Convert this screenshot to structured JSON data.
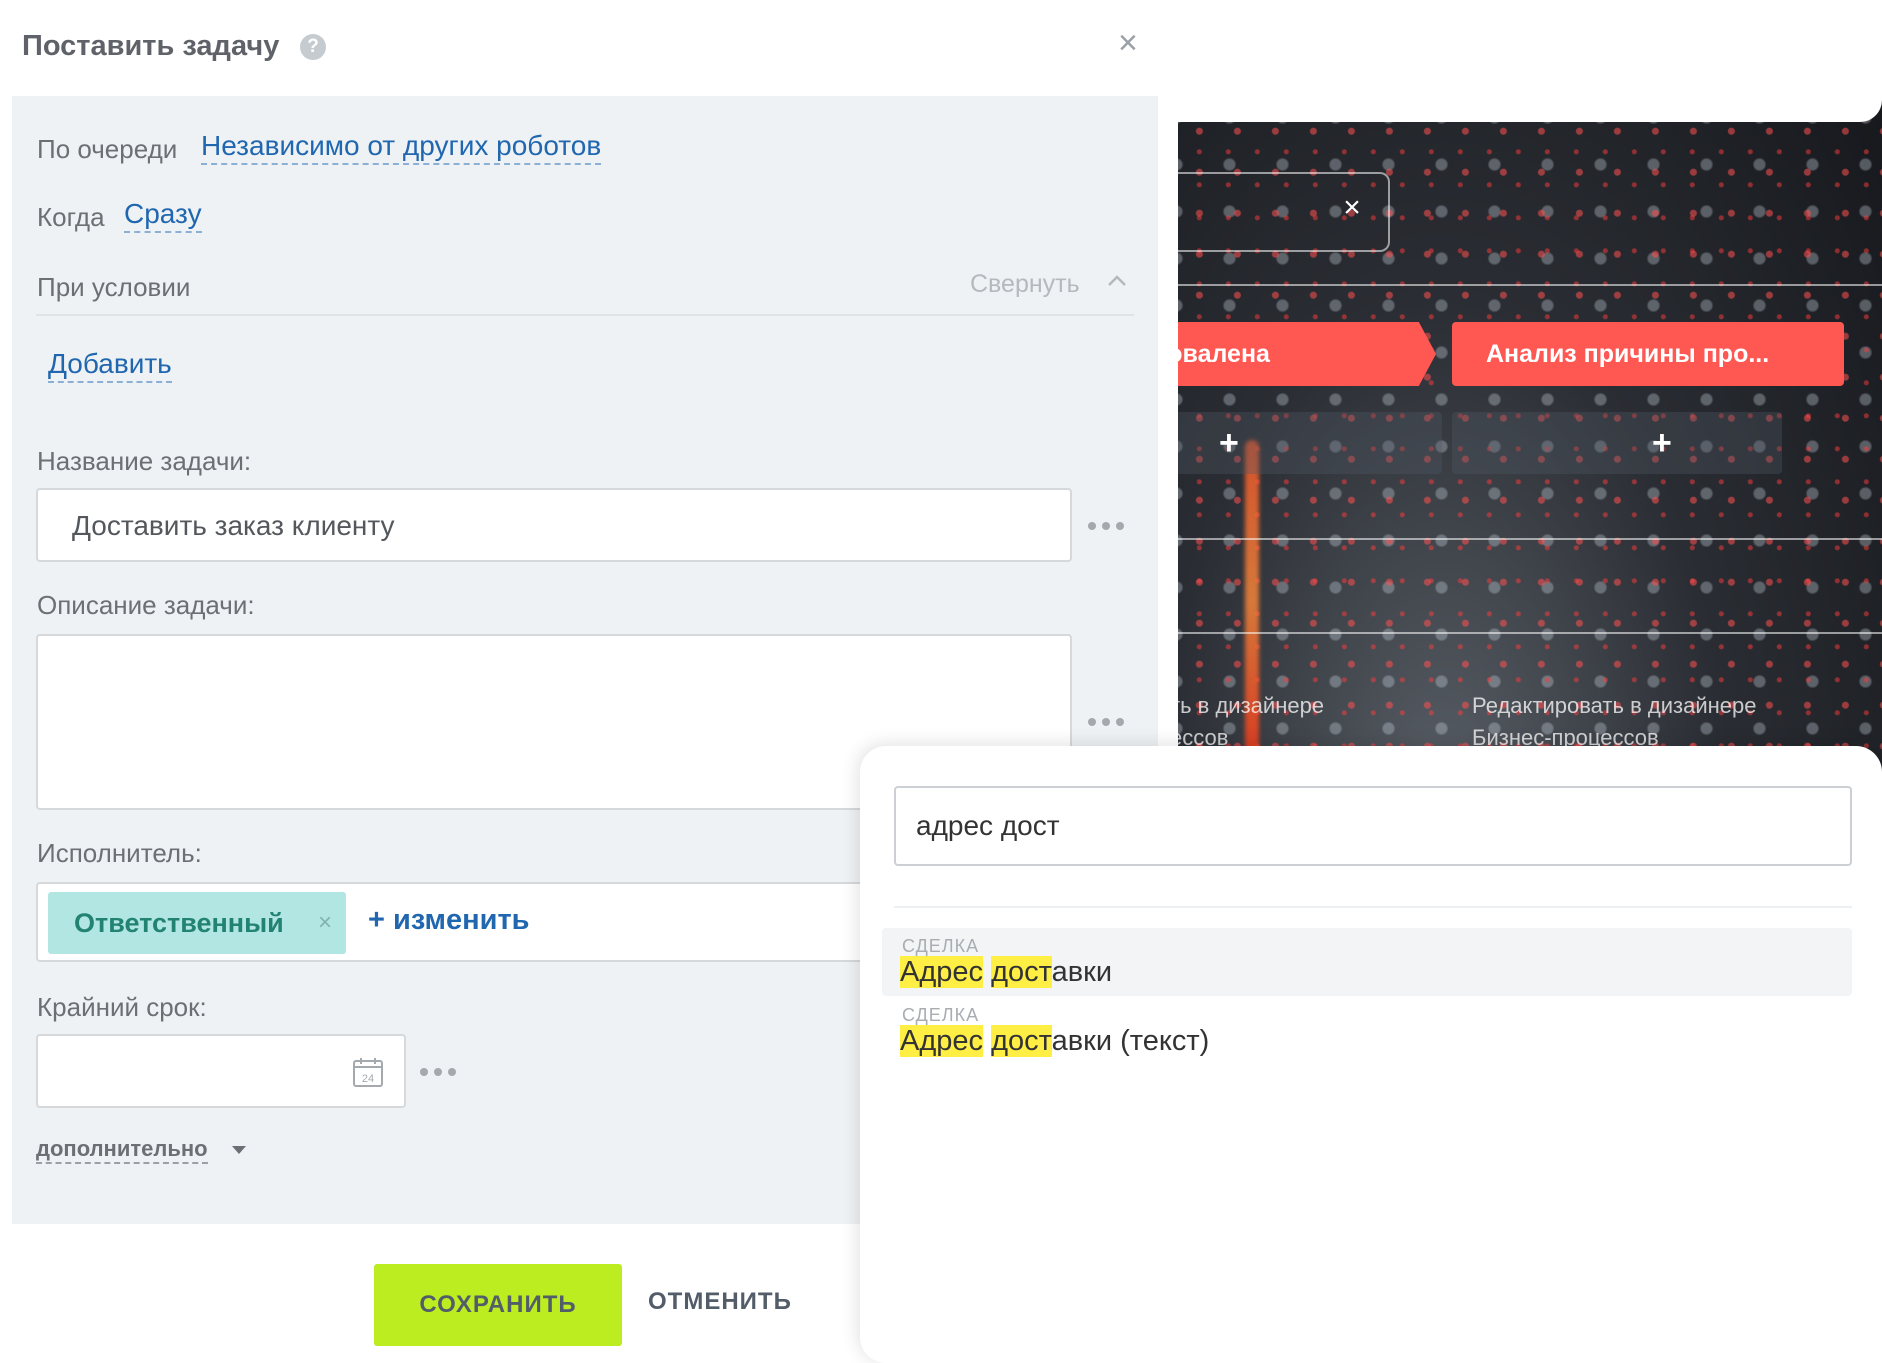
{
  "dialog": {
    "title": "Поставить задачу",
    "help_icon": "question-circle-icon",
    "close_icon": "close-icon"
  },
  "order": {
    "label": "По очереди",
    "value": "Независимо от других роботов"
  },
  "when": {
    "label": "Когда",
    "value": "Сразу"
  },
  "condition": {
    "label": "При условии",
    "collapse_label": "Свернуть",
    "add_label": "Добавить"
  },
  "task_name": {
    "label": "Название задачи:",
    "value": "Доставить заказ клиенту"
  },
  "task_description": {
    "label": "Описание задачи:",
    "value": ""
  },
  "assignee": {
    "label": "Исполнитель:",
    "tag": "Ответственный",
    "change_label": "+ изменить"
  },
  "deadline": {
    "label": "Крайний срок:",
    "value": "",
    "calendar_day": "24"
  },
  "more_label": "дополнительно",
  "buttons": {
    "save": "СОХРАНИТЬ",
    "cancel": "ОТМЕНИТЬ"
  },
  "search_popup": {
    "query": "адрес дост",
    "results": [
      {
        "category": "СДЕЛКА",
        "hl1": "Адрес",
        "sp": " ",
        "hl2": "дост",
        "rest": "авки"
      },
      {
        "category": "СДЕЛКА",
        "hl1": "Адрес",
        "sp": " ",
        "hl2": "дост",
        "rest": "авки (текст)"
      }
    ]
  },
  "background": {
    "stage_1": "ровалена",
    "stage_2": "Анализ причины про...",
    "edit_1_line1": "ть в дизайнере",
    "edit_1_line2": "ессов",
    "edit_2_line1": "Редактировать в дизайнере",
    "edit_2_line2": "Бизнес-процессов"
  },
  "colors": {
    "accent_link": "#2067b0",
    "save_button": "#bbed21",
    "stage_red": "#ff5752",
    "tag_bg": "#b2e6e2",
    "highlight": "#ffef45"
  }
}
